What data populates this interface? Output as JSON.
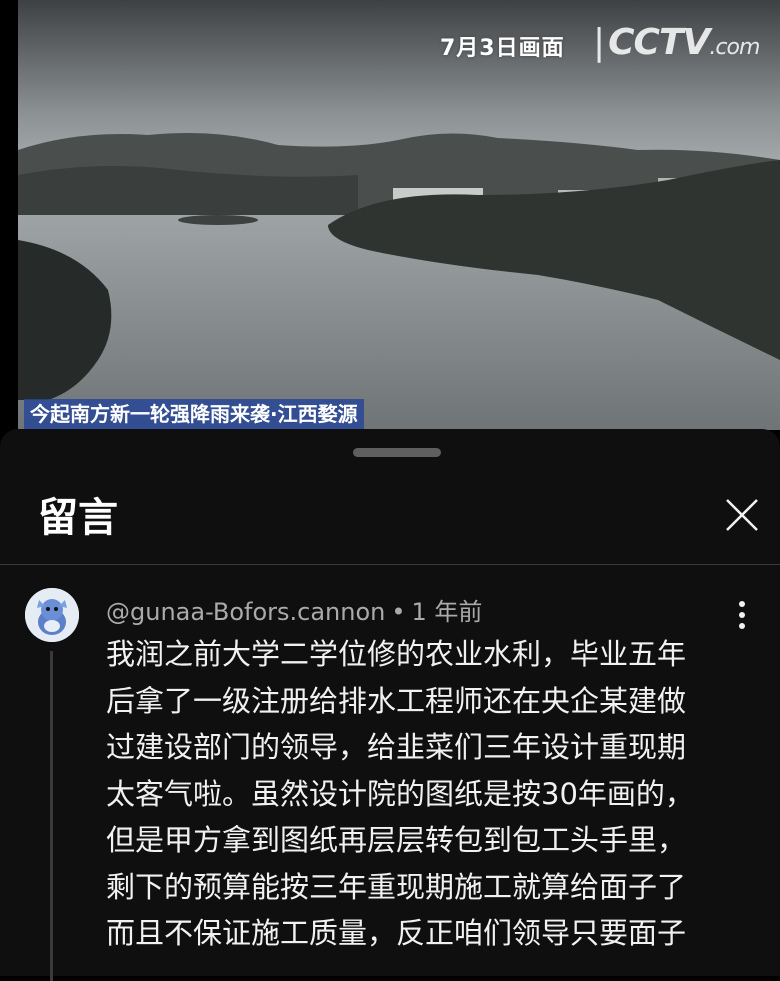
{
  "video": {
    "date_overlay": "7月3日画面",
    "logo_text": "CCTV",
    "logo_suffix": ".com",
    "caption": "今起南方新一轮强降雨来袭·江西婺源"
  },
  "sheet": {
    "title": "留言",
    "close_icon": "close-icon"
  },
  "comment": {
    "author": "@gunaa-Bofors.cannon",
    "separator": "•",
    "time": "1 年前",
    "more_icon": "more-vert-icon",
    "lines": [
      "我润之前大学二学位修的农业水利，毕业五年",
      "后拿了一级注册给排水工程师还在央企某建做",
      "过建设部门的领导，给韭菜们三年设计重现期",
      "太客气啦。虽然设计院的图纸是按30年画的，",
      "但是甲方拿到图纸再层层转包到包工头手里，",
      "剩下的预算能按三年重现期施工就算给面子了",
      "而且不保证施工质量，反正咱们领导只要面子"
    ]
  },
  "colors": {
    "sheet_bg": "#0f0f0f",
    "text": "#f1f1f1",
    "secondary_text": "#aaaaaa",
    "caption_bg": "#2846a0"
  }
}
